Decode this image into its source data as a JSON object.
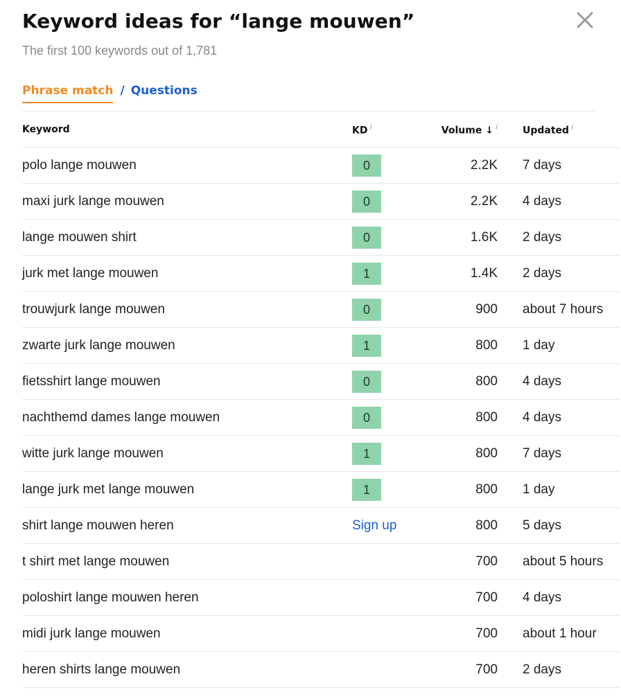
{
  "header": {
    "title": "Keyword ideas for “lange mouwen”",
    "subtitle": "The first 100 keywords out of 1,781"
  },
  "tabs": {
    "active": "Phrase match",
    "separator": "/",
    "other": "Questions"
  },
  "table": {
    "columns": {
      "keyword": "Keyword",
      "kd": "KD",
      "volume": "Volume ↓",
      "updated": "Updated",
      "info": "i"
    },
    "rows": [
      {
        "keyword": "polo lange mouwen",
        "kd": "0",
        "volume": "2.2K",
        "updated": "7 days"
      },
      {
        "keyword": "maxi jurk lange mouwen",
        "kd": "0",
        "volume": "2.2K",
        "updated": "4 days"
      },
      {
        "keyword": "lange mouwen shirt",
        "kd": "0",
        "volume": "1.6K",
        "updated": "2 days"
      },
      {
        "keyword": "jurk met lange mouwen",
        "kd": "1",
        "volume": "1.4K",
        "updated": "2 days"
      },
      {
        "keyword": "trouwjurk lange mouwen",
        "kd": "0",
        "volume": "900",
        "updated": "about 7 hours"
      },
      {
        "keyword": "zwarte jurk lange mouwen",
        "kd": "1",
        "volume": "800",
        "updated": "1 day"
      },
      {
        "keyword": "fietsshirt lange mouwen",
        "kd": "0",
        "volume": "800",
        "updated": "4 days"
      },
      {
        "keyword": "nachthemd dames lange mouwen",
        "kd": "0",
        "volume": "800",
        "updated": "4 days"
      },
      {
        "keyword": "witte jurk lange mouwen",
        "kd": "1",
        "volume": "800",
        "updated": "7 days"
      },
      {
        "keyword": "lange jurk met lange mouwen",
        "kd": "1",
        "volume": "800",
        "updated": "1 day"
      },
      {
        "keyword": "shirt lange mouwen heren",
        "kd": "Sign up",
        "volume": "800",
        "updated": "5 days"
      },
      {
        "keyword": "t shirt met lange mouwen",
        "kd": "",
        "volume": "700",
        "updated": "about 5 hours"
      },
      {
        "keyword": "poloshirt lange mouwen heren",
        "kd": "",
        "volume": "700",
        "updated": "4 days"
      },
      {
        "keyword": "midi jurk lange mouwen",
        "kd": "",
        "volume": "700",
        "updated": "about 1 hour"
      },
      {
        "keyword": "heren shirts lange mouwen",
        "kd": "",
        "volume": "700",
        "updated": "2 days"
      }
    ]
  },
  "colors": {
    "accent_orange": "#f08a24",
    "link_blue": "#1a5fd1",
    "kd_green": "#8fd3aa"
  },
  "icons": {
    "close": "close-icon",
    "sort": "arrow-down-icon",
    "info": "info-icon"
  }
}
